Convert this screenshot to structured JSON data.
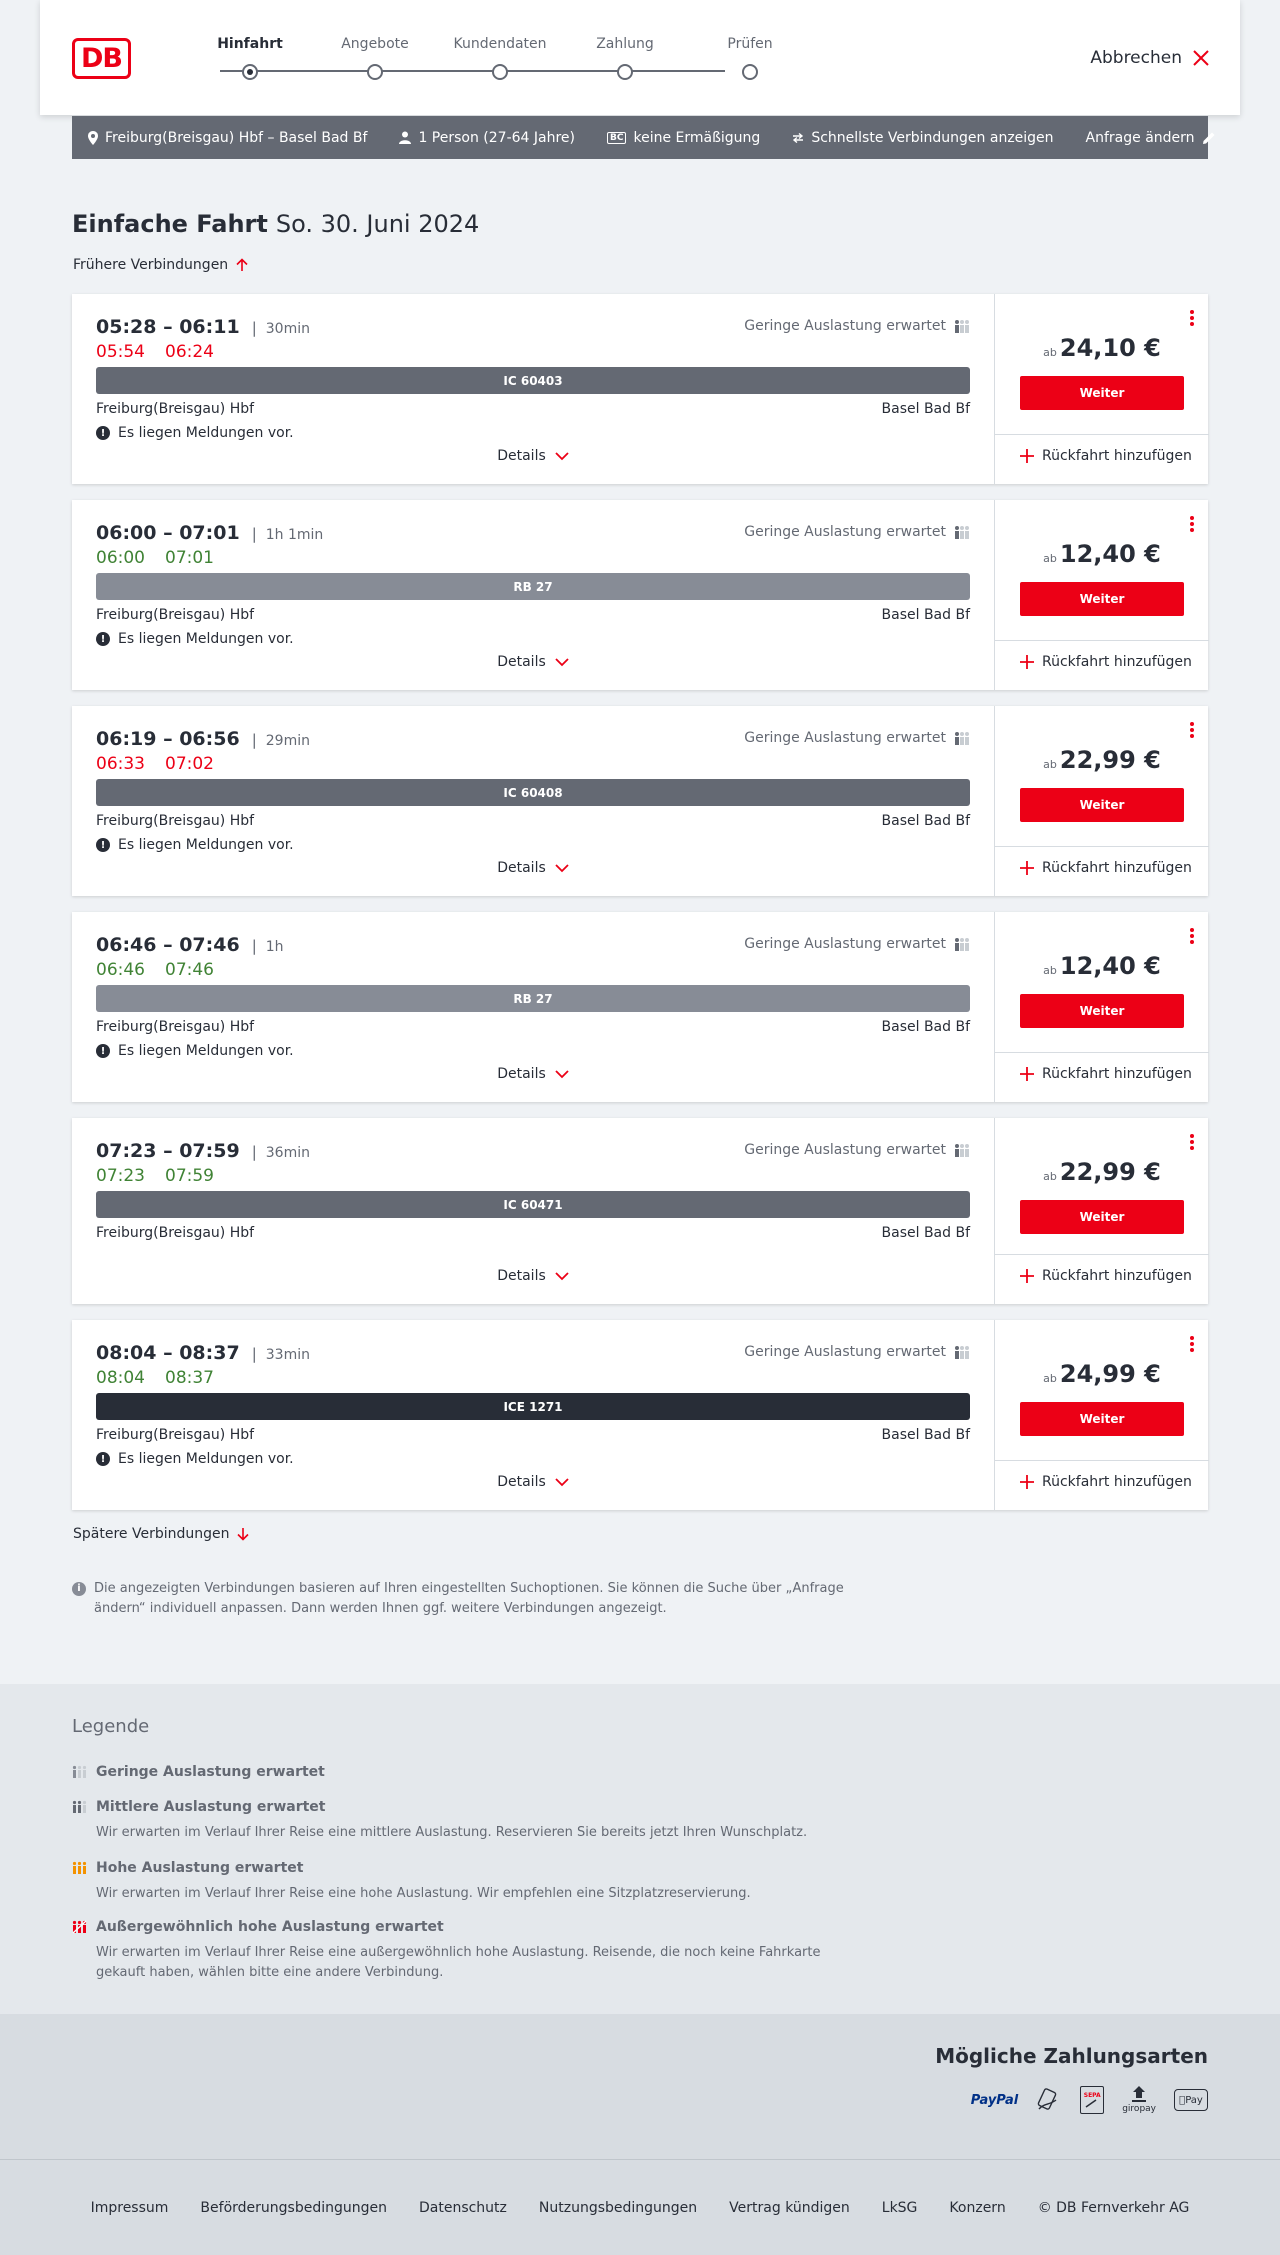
{
  "header": {
    "logo": "DB",
    "steps": [
      {
        "label": "Hinfahrt",
        "active": true
      },
      {
        "label": "Angebote",
        "active": false
      },
      {
        "label": "Kundendaten",
        "active": false
      },
      {
        "label": "Zahlung",
        "active": false
      },
      {
        "label": "Prüfen",
        "active": false
      }
    ],
    "cancel_label": "Abbrechen"
  },
  "query": {
    "route": "Freiburg(Breisgau) Hbf – Basel Bad Bf",
    "persons": "1 Person (27-64 Jahre)",
    "bahncard_icon_text": "BC",
    "discount": "keine Ermäßigung",
    "fastest": "Schnellste Verbindungen anzeigen",
    "change": "Anfrage ändern"
  },
  "page": {
    "title": "Einfache Fahrt",
    "date": "So. 30. Juni 2024",
    "earlier": "Frühere Verbindungen",
    "later": "Spätere Verbindungen",
    "info": "Die angezeigten Verbindungen basieren auf Ihren eingestellten Suchoptionen. Sie können die Suche über „Anfrage ändern“ individuell anpassen. Dann werden Ihnen ggf. weitere Verbindungen angezeigt."
  },
  "connections": [
    {
      "times": "05:28 – 06:11",
      "duration": "30min",
      "rt_dep": "05:54",
      "rt_arr": "06:24",
      "rt_status": "late",
      "occupancy": "Geringe Auslastung erwartet",
      "train": "IC 60403",
      "train_type": "ic",
      "from": "Freiburg(Breisgau) Hbf",
      "to": "Basel Bad Bf",
      "message": "Es liegen Meldungen vor.",
      "details": "Details",
      "price_prefix": "ab",
      "price": "24,10 €",
      "button": "Weiter",
      "return": "Rückfahrt hinzufügen"
    },
    {
      "times": "06:00 – 07:01",
      "duration": "1h 1min",
      "rt_dep": "06:00",
      "rt_arr": "07:01",
      "rt_status": "ok",
      "occupancy": "Geringe Auslastung erwartet",
      "train": "RB 27",
      "train_type": "rb",
      "from": "Freiburg(Breisgau) Hbf",
      "to": "Basel Bad Bf",
      "message": "Es liegen Meldungen vor.",
      "details": "Details",
      "price_prefix": "ab",
      "price": "12,40 €",
      "button": "Weiter",
      "return": "Rückfahrt hinzufügen"
    },
    {
      "times": "06:19 – 06:56",
      "duration": "29min",
      "rt_dep": "06:33",
      "rt_arr": "07:02",
      "rt_status": "late",
      "occupancy": "Geringe Auslastung erwartet",
      "train": "IC 60408",
      "train_type": "ic",
      "from": "Freiburg(Breisgau) Hbf",
      "to": "Basel Bad Bf",
      "message": "Es liegen Meldungen vor.",
      "details": "Details",
      "price_prefix": "ab",
      "price": "22,99 €",
      "button": "Weiter",
      "return": "Rückfahrt hinzufügen"
    },
    {
      "times": "06:46 – 07:46",
      "duration": "1h",
      "rt_dep": "06:46",
      "rt_arr": "07:46",
      "rt_status": "ok",
      "occupancy": "Geringe Auslastung erwartet",
      "train": "RB 27",
      "train_type": "rb",
      "from": "Freiburg(Breisgau) Hbf",
      "to": "Basel Bad Bf",
      "message": "Es liegen Meldungen vor.",
      "details": "Details",
      "price_prefix": "ab",
      "price": "12,40 €",
      "button": "Weiter",
      "return": "Rückfahrt hinzufügen"
    },
    {
      "times": "07:23 – 07:59",
      "duration": "36min",
      "rt_dep": "07:23",
      "rt_arr": "07:59",
      "rt_status": "ok",
      "occupancy": "Geringe Auslastung erwartet",
      "train": "IC 60471",
      "train_type": "ic",
      "from": "Freiburg(Breisgau) Hbf",
      "to": "Basel Bad Bf",
      "message": "",
      "details": "Details",
      "price_prefix": "ab",
      "price": "22,99 €",
      "button": "Weiter",
      "return": "Rückfahrt hinzufügen"
    },
    {
      "times": "08:04 – 08:37",
      "duration": "33min",
      "rt_dep": "08:04",
      "rt_arr": "08:37",
      "rt_status": "ok",
      "occupancy": "Geringe Auslastung erwartet",
      "train": "ICE 1271",
      "train_type": "ice",
      "from": "Freiburg(Breisgau) Hbf",
      "to": "Basel Bad Bf",
      "message": "Es liegen Meldungen vor.",
      "details": "Details",
      "price_prefix": "ab",
      "price": "24,99 €",
      "button": "Weiter",
      "return": "Rückfahrt hinzufügen"
    }
  ],
  "legend": {
    "title": "Legende",
    "items": [
      {
        "title": "Geringe Auslastung erwartet",
        "text": "",
        "level": 1,
        "color": "#878c96"
      },
      {
        "title": "Mittlere Auslastung erwartet",
        "text": "Wir erwarten im Verlauf Ihrer Reise eine mittlere Auslastung. Reservieren Sie bereits jetzt Ihren Wunschplatz.",
        "level": 2,
        "color": "#646973"
      },
      {
        "title": "Hohe Auslastung erwartet",
        "text": "Wir erwarten im Verlauf Ihrer Reise eine hohe Auslastung. Wir empfehlen eine Sitzplatzreservierung.",
        "level": 3,
        "color": "#f39200"
      },
      {
        "title": "Außergewöhnlich hohe Auslastung erwartet",
        "text": "Wir erwarten im Verlauf Ihrer Reise eine außergewöhnlich hohe Auslastung. Reisende, die noch keine Fahrkarte gekauft haben, wählen bitte eine andere Verbindung.",
        "level": 4,
        "color": "#ec0016"
      }
    ]
  },
  "payment": {
    "title": "Mögliche Zahlungsarten",
    "methods": [
      "PayPal",
      "SEPA",
      "giropay",
      "Pay"
    ]
  },
  "footer": {
    "links": [
      "Impressum",
      "Beförderungsbedingungen",
      "Datenschutz",
      "Nutzungsbedingungen",
      "Vertrag kündigen",
      "LkSG",
      "Konzern",
      "© DB Fernverkehr AG"
    ]
  },
  "colors": {
    "brand_red": "#ec0016",
    "late": "#ec0016",
    "on_time": "#408335",
    "text": "#282d37",
    "muted": "#646973"
  }
}
